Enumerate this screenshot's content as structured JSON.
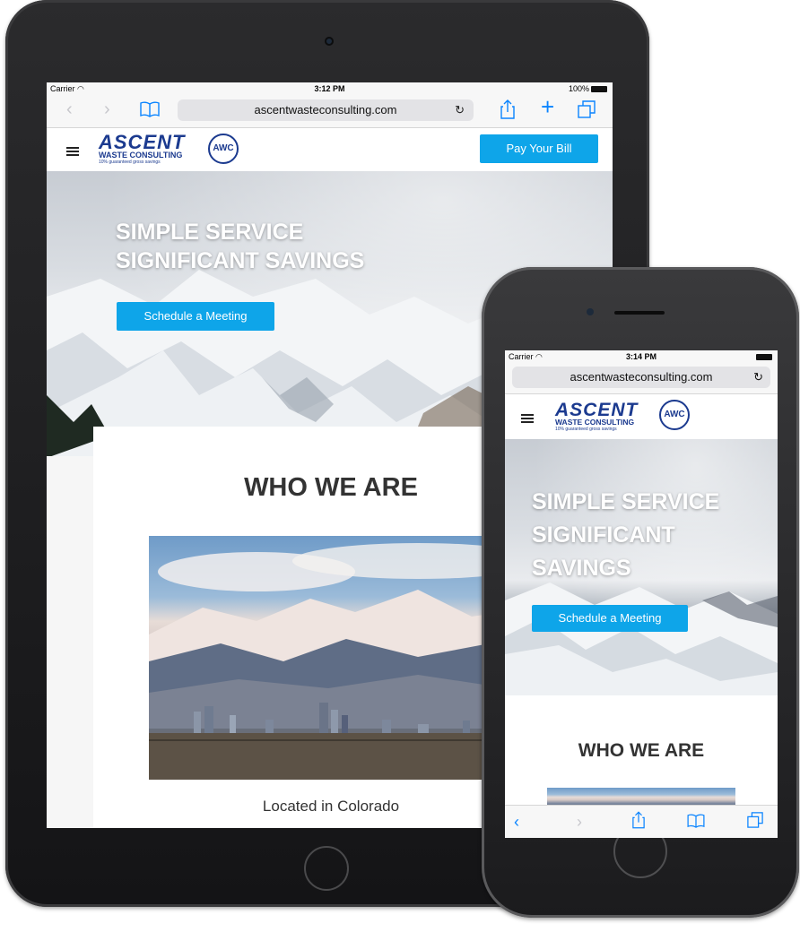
{
  "tablet": {
    "status": {
      "carrier": "Carrier",
      "time": "3:12 PM",
      "battery": "100%"
    },
    "browser": {
      "url": "ascentwasteconsulting.com",
      "reload": "↻"
    },
    "header": {
      "logo_main": "ASCENT",
      "logo_sub": "WASTE CONSULTING",
      "logo_tag": "10% guaranteed gross savings",
      "logo_badge": "AWC",
      "pay_button": "Pay Your Bill"
    },
    "hero": {
      "line1": "SIMPLE SERVICE",
      "line2": "SIGNIFICANT SAVINGS",
      "button": "Schedule a Meeting"
    },
    "section": {
      "title": "WHO WE ARE",
      "caption": "Located in Colorado"
    }
  },
  "phone": {
    "status": {
      "carrier": "Carrier",
      "time": "3:14 PM"
    },
    "browser": {
      "url": "ascentwasteconsulting.com",
      "reload": "↻"
    },
    "header": {
      "logo_main": "ASCENT",
      "logo_sub": "WASTE CONSULTING",
      "logo_tag": "10% guaranteed gross savings",
      "logo_badge": "AWC"
    },
    "hero": {
      "line1": "SIMPLE SERVICE",
      "line2": "SIGNIFICANT",
      "line3": "SAVINGS",
      "button": "Schedule a Meeting"
    },
    "section": {
      "title": "WHO WE ARE"
    }
  },
  "colors": {
    "brand_blue": "#1b3a8f",
    "button_blue": "#0ea5e9",
    "ios_blue": "#0a84ff"
  }
}
